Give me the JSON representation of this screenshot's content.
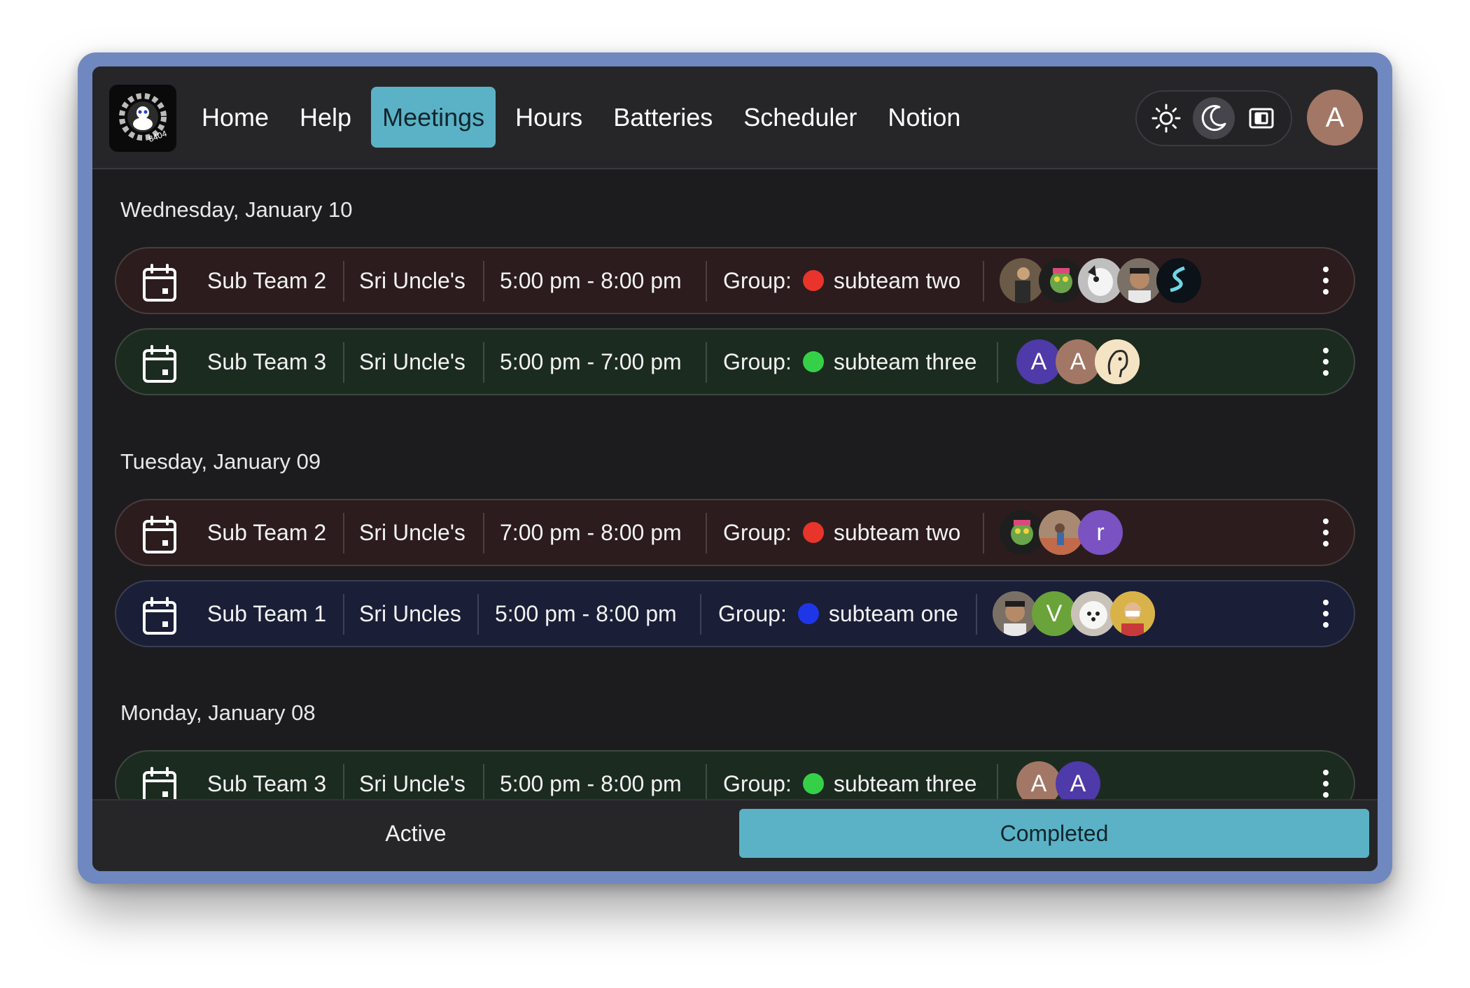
{
  "nav": {
    "items": [
      "Home",
      "Help",
      "Meetings",
      "Hours",
      "Batteries",
      "Scheduler",
      "Notion"
    ],
    "active": "Meetings",
    "logo_text": "8404"
  },
  "theme": {
    "options": [
      "light",
      "dark",
      "system"
    ],
    "selected": "dark"
  },
  "user": {
    "initial": "A"
  },
  "groups": [
    {
      "date": "Wednesday, January 10",
      "meetings": [
        {
          "team": "Sub Team 2",
          "location": "Sri Uncle's",
          "time": "5:00 pm - 8:00 pm",
          "group_label": "Group:",
          "group": "subteam two",
          "color": "#e8342a"
        },
        {
          "team": "Sub Team 3",
          "location": "Sri Uncle's",
          "time": "5:00 pm - 7:00 pm",
          "group_label": "Group:",
          "group": "subteam three",
          "color": "#36d048"
        }
      ]
    },
    {
      "date": "Tuesday, January 09",
      "meetings": [
        {
          "team": "Sub Team 2",
          "location": "Sri Uncle's",
          "time": "7:00 pm - 8:00 pm",
          "group_label": "Group:",
          "group": "subteam two",
          "color": "#e8342a"
        },
        {
          "team": "Sub Team 1",
          "location": "Sri Uncles",
          "time": "5:00 pm - 8:00 pm",
          "group_label": "Group:",
          "group": "subteam one",
          "color": "#1e36e8"
        }
      ]
    },
    {
      "date": "Monday, January 08",
      "meetings": [
        {
          "team": "Sub Team 3",
          "location": "Sri Uncle's",
          "time": "5:00 pm - 8:00 pm",
          "group_label": "Group:",
          "group": "subteam three",
          "color": "#36d048"
        }
      ]
    }
  ],
  "avatar_letters": {
    "row2": [
      "A",
      "A"
    ],
    "row3": [
      "r"
    ],
    "row4": [
      "V"
    ],
    "row5": [
      "A",
      "A"
    ]
  },
  "tabs": {
    "active_label": "Active",
    "completed_label": "Completed",
    "selected": "Completed"
  }
}
